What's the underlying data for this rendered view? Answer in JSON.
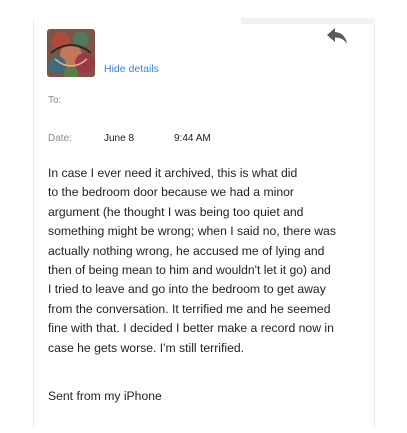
{
  "header": {
    "hide_details_label": "Hide details",
    "reply_icon": "reply-arrow-icon",
    "avatar_icon": "sender-avatar"
  },
  "meta": {
    "to_label": "To:",
    "date_label": "Date:",
    "date_value": "June 8",
    "time_value": "9:44 AM"
  },
  "message": {
    "body": "In case I ever need it archived, this is what        did\nto the bedroom door because we had a minor\nargument (he thought I was being too quiet and\nsomething might be wrong; when I said no, there was\nactually nothing wrong, he accused me of lying and\nthen of being mean to him and wouldn't let it go) and\nI tried to leave and go into the bedroom to get away\nfrom the conversation. It terrified me and he seemed\nfine with that. I decided I better make a record now in\ncase he gets worse. I'm still terrified.",
    "signature": "Sent from my iPhone"
  },
  "colors": {
    "link": "#3b82e0",
    "meta_text": "#8a8a8e",
    "body_text": "#222222",
    "icon": "#555a63"
  }
}
